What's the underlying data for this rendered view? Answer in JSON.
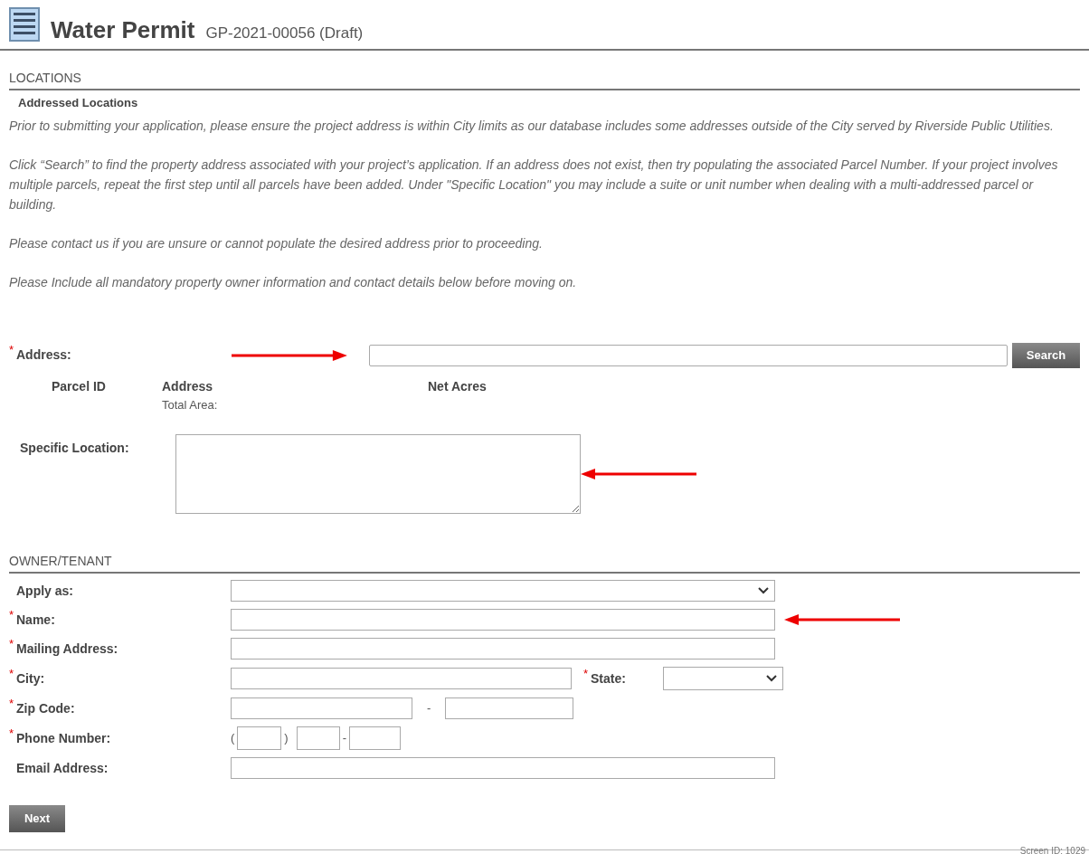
{
  "header": {
    "title": "Water Permit",
    "subtitle": "GP-2021-00056 (Draft)"
  },
  "locations": {
    "section_title": "LOCATIONS",
    "subsection_title": "Addressed Locations",
    "instructions": [
      "Prior to submitting your application, please ensure the project address is within City limits as our database includes some addresses outside of the City served by Riverside Public Utilities.",
      "Click “Search” to find the property address associated with your project’s application. If an address does not exist, then try populating the associated Parcel Number. If your project involves multiple parcels, repeat the first step until all parcels have been added. Under \"Specific Location\" you may include a suite or unit number when dealing with a multi-addressed parcel or building.",
      "Please contact us if you are unsure or cannot populate the desired address prior to proceeding.",
      "Please Include all mandatory property owner information and contact details below before moving on."
    ],
    "address": {
      "label": "Address:",
      "required_mark": "*",
      "search_button": "Search"
    },
    "parcel_columns": [
      "Parcel ID",
      "Address",
      "Net Acres"
    ],
    "total_area_label": "Total Area:",
    "specific_location": {
      "label": "Specific Location:"
    }
  },
  "owner": {
    "section_title": "OWNER/TENANT",
    "fields": [
      {
        "kind": "select",
        "label": "Apply as:"
      },
      {
        "kind": "text",
        "label": "Name:",
        "required_mark": "*"
      },
      {
        "kind": "text",
        "label": "Mailing Address:",
        "required_mark": "*"
      },
      {
        "kind": "city",
        "label": "City:",
        "required_mark": "*",
        "state_label": "State:",
        "state_required_mark": "*"
      },
      {
        "kind": "zip",
        "label": "Zip Code:",
        "required_mark": "*",
        "separator": "-"
      },
      {
        "kind": "phone",
        "label": "Phone Number:",
        "required_mark": "*",
        "open": "(",
        "close": ")",
        "separator": "-"
      },
      {
        "kind": "text",
        "label": "Email Address:"
      }
    ]
  },
  "next_button": "Next",
  "footer": "Screen ID: 1029"
}
